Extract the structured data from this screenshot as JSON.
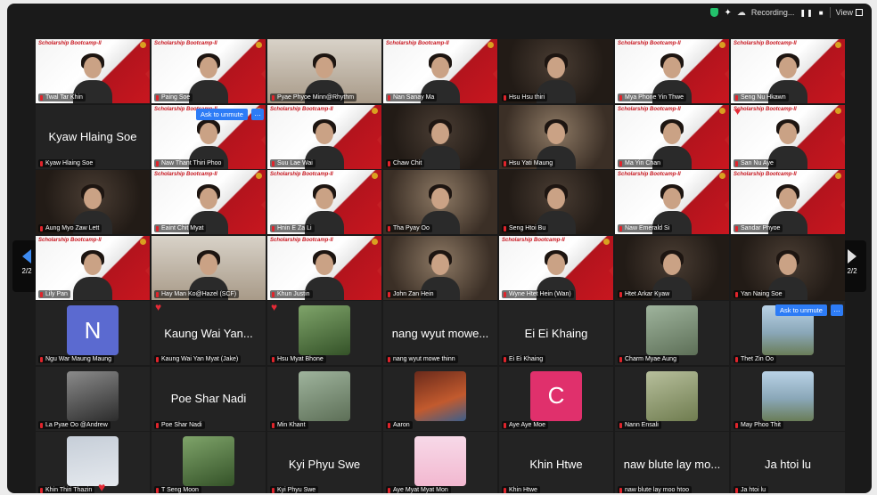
{
  "topbar": {
    "recording_label": "Recording...",
    "pause_icon": "pause-icon",
    "stop_icon": "stop-icon",
    "view_label": "View"
  },
  "pager": {
    "left_page": "2/2",
    "right_page": "2/2"
  },
  "slide_brand": "Scholarship Bootcamp-II",
  "colors": {
    "background": "#1a1a1a",
    "accent_blue": "#2d7cf6",
    "brand_red": "#c8161f",
    "security_green": "#23c16b",
    "heart_red": "#e42a36"
  },
  "tiles": [
    {
      "name": "Twal Tar Khin",
      "kind": "slides"
    },
    {
      "name": "Paing Soe",
      "kind": "slides"
    },
    {
      "name": "Pyae Phyoe Minn@Rhythm",
      "kind": "cam-light"
    },
    {
      "name": "Nan Sanay Ma",
      "kind": "slides"
    },
    {
      "name": "Hsu Hsu thiri",
      "kind": "cam-dark"
    },
    {
      "name": "Mya Phone Yin Thwe",
      "kind": "slides"
    },
    {
      "name": "Seng Nu Hkawn",
      "kind": "slides"
    },
    {
      "name": "Kyaw Hlaing Soe",
      "kind": "name-only",
      "big": "Kyaw Hlaing Soe"
    },
    {
      "name": "Naw Thant Thiri Phoo",
      "kind": "slides",
      "ask": "Ask to unmute"
    },
    {
      "name": "Suu Lae Wai",
      "kind": "slides"
    },
    {
      "name": "Chaw Chit",
      "kind": "cam-dark"
    },
    {
      "name": "Hsu Yati Maung",
      "kind": "cam-warm"
    },
    {
      "name": "Ma Yin Chan",
      "kind": "slides"
    },
    {
      "name": "San Nu Aye",
      "kind": "slides",
      "heart": true
    },
    {
      "name": "Aung Myo Zaw Lett",
      "kind": "cam-dark"
    },
    {
      "name": "Eaint Chit Myat",
      "kind": "slides"
    },
    {
      "name": "Hnin E Za Li",
      "kind": "slides"
    },
    {
      "name": "Tha Pyay Oo",
      "kind": "cam-warm"
    },
    {
      "name": "Seng Htoi Bu",
      "kind": "cam-dark"
    },
    {
      "name": "Naw Emerald Si",
      "kind": "slides"
    },
    {
      "name": "Sandar Phyoe",
      "kind": "slides"
    },
    {
      "name": "Lily Pan",
      "kind": "slides"
    },
    {
      "name": "Hay Man Ko@Hazel (SCF)",
      "kind": "cam-light"
    },
    {
      "name": "Khun Justin",
      "kind": "slides"
    },
    {
      "name": "John Zan Hein",
      "kind": "cam-warm"
    },
    {
      "name": "Wyne Htet Hein (Wan)",
      "kind": "slides"
    },
    {
      "name": "Htet Arkar Kyaw",
      "kind": "cam-dark"
    },
    {
      "name": "Yan Naing Soe",
      "kind": "cam-dark"
    },
    {
      "name": "Ngu War Maung Maung",
      "kind": "avatar",
      "letter": "N",
      "color": "#5b6ad0"
    },
    {
      "name": "Kaung Wai Yan Myat (Jake)",
      "kind": "name-only",
      "big": "Kaung Wai Yan...",
      "heart": true
    },
    {
      "name": "Hsu Myat Bhone",
      "kind": "photo",
      "photo": "green",
      "heart": true
    },
    {
      "name": "nang wyut mowe thinn",
      "kind": "name-only",
      "big": "nang wyut mowe..."
    },
    {
      "name": "Ei Ei Khaing",
      "kind": "name-only",
      "big": "Ei Ei Khaing"
    },
    {
      "name": "Charm Myae Aung",
      "kind": "photo",
      "photo": "glass"
    },
    {
      "name": "Thet Zin Oo",
      "kind": "photo",
      "photo": "sky",
      "ask": "Ask to unmute"
    },
    {
      "name": "La Pyae Oo @Andrew",
      "kind": "photo",
      "photo": "bw"
    },
    {
      "name": "Poe Shar Nadi",
      "kind": "name-only",
      "big": "Poe Shar Nadi"
    },
    {
      "name": "Min Khant",
      "kind": "photo",
      "photo": "glass"
    },
    {
      "name": "Aaron",
      "kind": "photo",
      "photo": "olaf"
    },
    {
      "name": "Aye Aye Moe",
      "kind": "avatar",
      "letter": "C",
      "color": "#e0306c"
    },
    {
      "name": "Nann Ensali",
      "kind": "photo",
      "photo": "leaf"
    },
    {
      "name": "May Phoo Thit",
      "kind": "photo",
      "photo": "sky"
    },
    {
      "name": "Khin Thiri Thazin",
      "kind": "photo",
      "photo": "snow",
      "heart_bottom": true
    },
    {
      "name": "T Seng Moon",
      "kind": "photo",
      "photo": "green"
    },
    {
      "name": "Kyi Phyu Swe",
      "kind": "name-only",
      "big": "Kyi Phyu Swe"
    },
    {
      "name": "Aye Myat Myat Mon",
      "kind": "photo",
      "photo": "pink"
    },
    {
      "name": "Khin Htwe",
      "kind": "name-only",
      "big": "Khin Htwe"
    },
    {
      "name": "naw blute lay moo htoo",
      "kind": "name-only",
      "big": "naw blute lay mo..."
    },
    {
      "name": "Ja htoi lu",
      "kind": "name-only",
      "big": "Ja htoi lu"
    }
  ]
}
